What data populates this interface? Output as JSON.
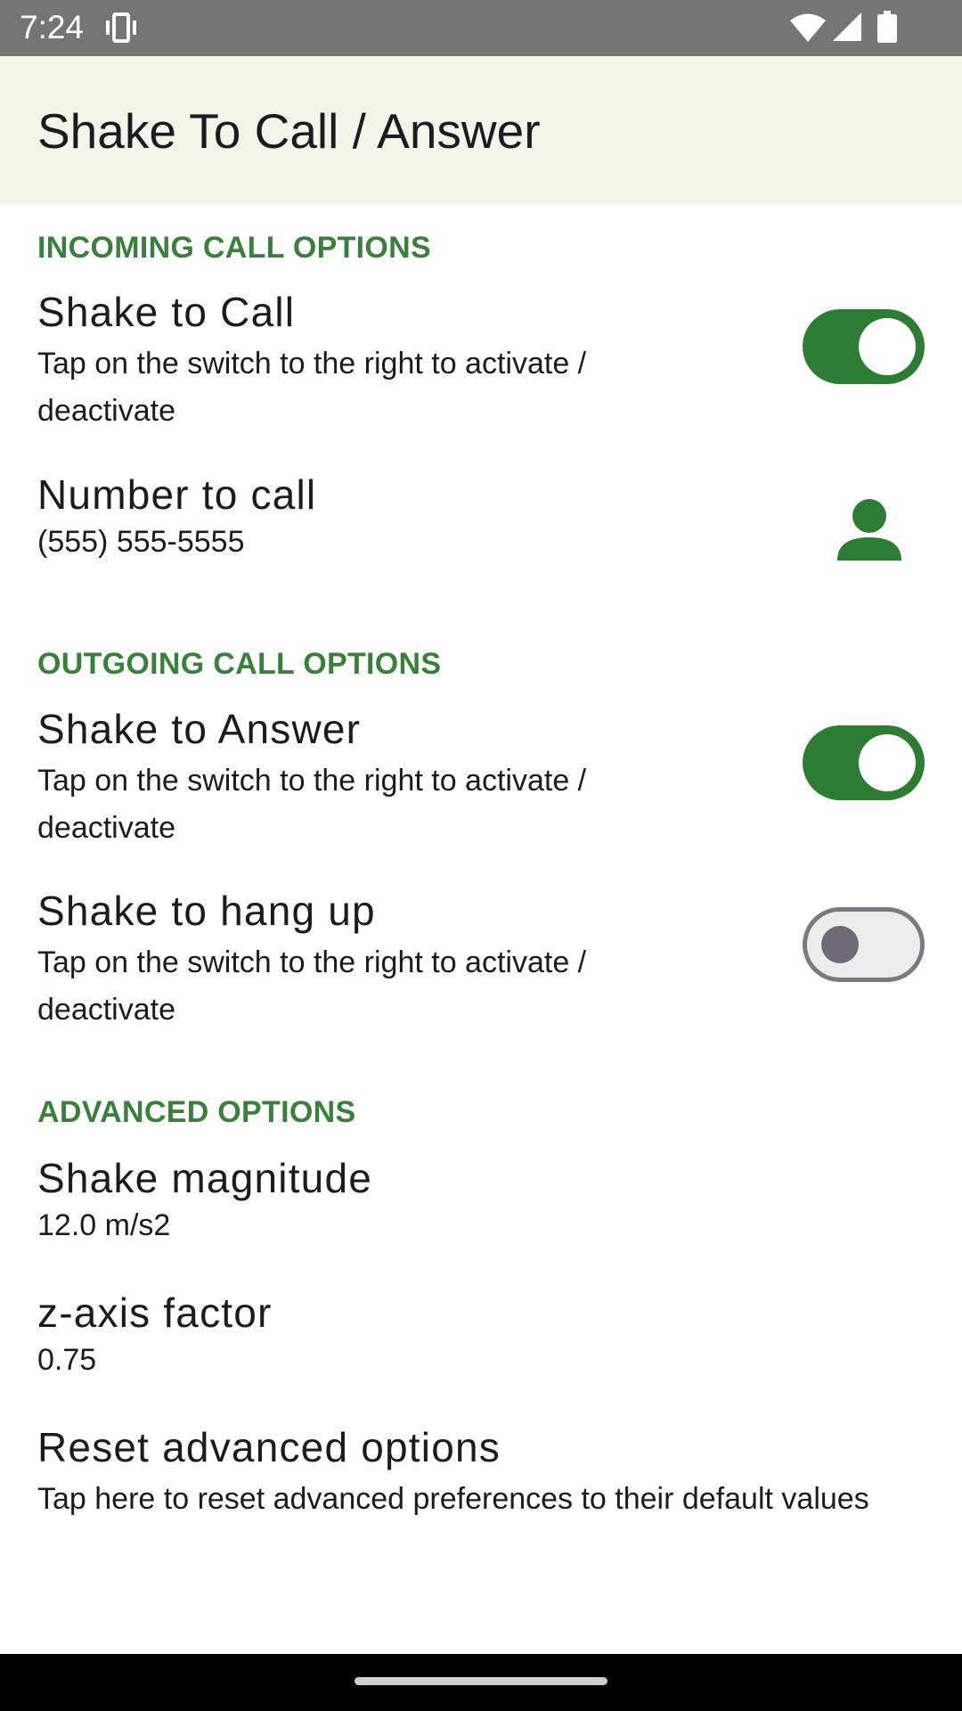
{
  "status_bar": {
    "time": "7:24",
    "icons": [
      "vibrate-icon",
      "wifi-icon",
      "signal-icon",
      "battery-icon"
    ]
  },
  "app_bar": {
    "title": "Shake To Call / Answer"
  },
  "sections": {
    "incoming": {
      "header": "INCOMING CALL OPTIONS",
      "shake_to_call": {
        "title": "Shake to Call",
        "summary": "Tap on the switch to the right to activate / deactivate",
        "enabled": true
      },
      "number_to_call": {
        "title": "Number to call",
        "value": "(555) 555-5555",
        "icon": "contact-icon"
      }
    },
    "outgoing": {
      "header": "OUTGOING CALL OPTIONS",
      "shake_to_answer": {
        "title": "Shake to Answer",
        "summary": "Tap on the switch to the right to activate / deactivate",
        "enabled": true
      },
      "shake_to_hang_up": {
        "title": "Shake to hang up",
        "summary": "Tap on the switch to the right to activate / deactivate",
        "enabled": false
      }
    },
    "advanced": {
      "header": "ADVANCED OPTIONS",
      "shake_magnitude": {
        "title": "Shake magnitude",
        "value": "12.0 m/s2"
      },
      "z_axis_factor": {
        "title": "z-axis factor",
        "value": "0.75"
      },
      "reset": {
        "title": "Reset advanced options",
        "summary": "Tap here to reset advanced preferences to their default values"
      }
    }
  },
  "colors": {
    "accent": "#2e7d34",
    "section_header": "#3a7f3c",
    "app_bar_bg": "#f1f6e9",
    "status_bar_bg": "#757575"
  }
}
